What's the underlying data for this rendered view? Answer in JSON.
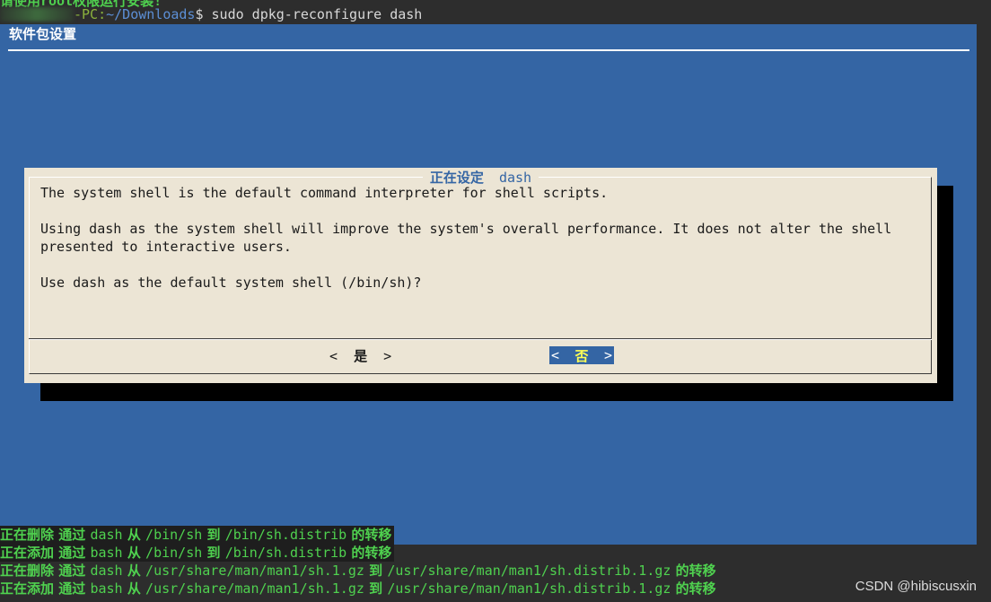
{
  "terminal": {
    "top_cut_text": "请使用root权限运行安装!",
    "prompt_host": "-PC:",
    "prompt_path": "~/Downloads",
    "prompt_symbol": "$",
    "command": "sudo dpkg-reconfigure dash"
  },
  "backdrop": {
    "title": "软件包设置"
  },
  "dialog": {
    "title_cjk": "正在设定",
    "title_pkg": "dash",
    "lines": [
      "The system shell is the default command interpreter for shell scripts.",
      "Using dash as the system shell will improve the system's overall performance. It does not alter the shell",
      "presented to interactive users.",
      "Use dash as the default system shell (/bin/sh)?"
    ],
    "buttons": {
      "yes_left": "<",
      "yes_label": "是",
      "yes_right": ">",
      "no_left": "<",
      "no_label": "否",
      "no_right": ">"
    }
  },
  "output_lines": [
    {
      "a": "正在删除",
      "b": " 通过 ",
      "c": "dash",
      "d": " 从 ",
      "e": "/bin/sh",
      "f": " 到 ",
      "g": "/bin/sh.distrib",
      "h": " 的转移"
    },
    {
      "a": "正在添加",
      "b": " 通过 ",
      "c": "bash",
      "d": " 从 ",
      "e": "/bin/sh",
      "f": " 到 ",
      "g": "/bin/sh.distrib",
      "h": " 的转移"
    },
    {
      "a": "正在删除",
      "b": " 通过 ",
      "c": "dash",
      "d": " 从 ",
      "e": "/usr/share/man/man1/sh.1.gz",
      "f": " 到 ",
      "g": "/usr/share/man/man1/sh.distrib.1.gz",
      "h": " 的转移"
    },
    {
      "a": "正在添加",
      "b": " 通过 ",
      "c": "bash",
      "d": " 从 ",
      "e": "/usr/share/man/man1/sh.1.gz",
      "f": " 到 ",
      "g": "/usr/share/man/man1/sh.distrib.1.gz",
      "h": " 的转移"
    }
  ],
  "watermark": "CSDN @hibiscusxin",
  "colors": {
    "terminal_green": "#4fd14f",
    "backdrop_blue": "#3465a4",
    "dialog_bg": "#ece5d5",
    "button_highlight_label": "#ffff55"
  }
}
